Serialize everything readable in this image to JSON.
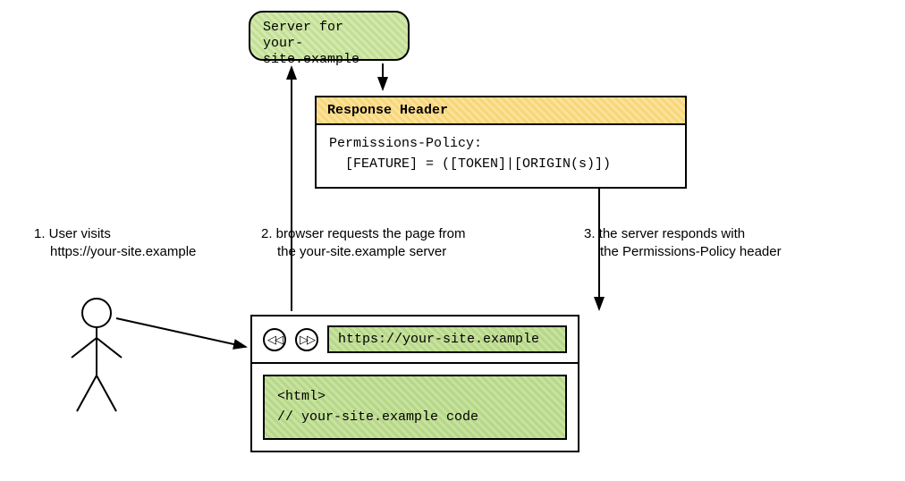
{
  "server": {
    "line1": "Server for",
    "line2": "your-site.example"
  },
  "response": {
    "title": "Response Header",
    "line1": "Permissions-Policy:",
    "line2": "  [FEATURE] = ([TOKEN]|[ORIGIN(s)])"
  },
  "steps": {
    "one_a": "1. User visits",
    "one_b": "https://your-site.example",
    "two_a": "2. browser requests the page from",
    "two_b": "the your-site.example server",
    "three_a": "3. the server responds with",
    "three_b": "the Permissions-Policy header"
  },
  "browser": {
    "back_glyph": "◁◁",
    "fwd_glyph": "▷▷",
    "url": "https://your-site.example",
    "code_line1": "<html>",
    "code_line2": "// your-site.example code"
  }
}
